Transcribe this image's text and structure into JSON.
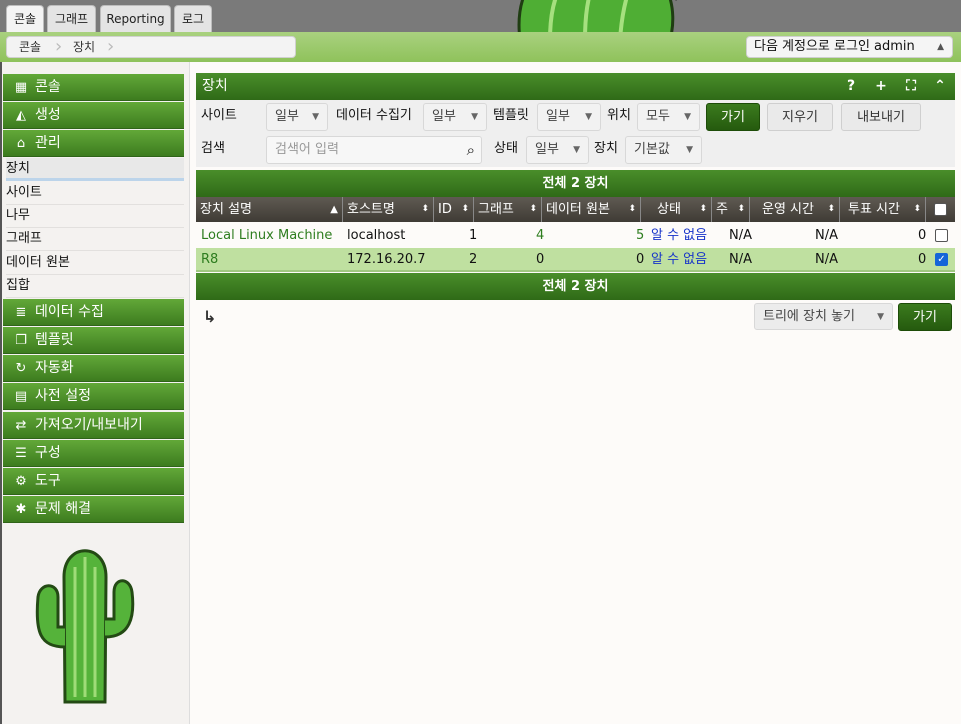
{
  "tabs": [
    {
      "label": "콘솔",
      "active": true
    },
    {
      "label": "그래프",
      "active": false
    },
    {
      "label": "Reporting",
      "active": false
    },
    {
      "label": "로그",
      "active": false
    }
  ],
  "breadcrumb": [
    "콘솔",
    "장치"
  ],
  "login_text": "다음 계정으로 로그인 admin",
  "sidebar": {
    "sections": [
      {
        "label": "콘솔",
        "icon": "map-icon"
      },
      {
        "label": "생성",
        "icon": "area-chart-icon"
      },
      {
        "label": "관리",
        "icon": "home-icon"
      }
    ],
    "manage_items": [
      "장치",
      "사이트",
      "나무",
      "그래프",
      "데이터 원본",
      "집합"
    ],
    "more_sections": [
      {
        "label": "데이터 수집",
        "icon": "database-icon"
      },
      {
        "label": "템플릿",
        "icon": "copy-icon"
      },
      {
        "label": "자동화",
        "icon": "sync-icon"
      },
      {
        "label": "사전 설정",
        "icon": "archive-icon"
      },
      {
        "label": "가져오기/내보내기",
        "icon": "exchange-icon"
      },
      {
        "label": "구성",
        "icon": "sliders-icon"
      },
      {
        "label": "도구",
        "icon": "cogs-icon"
      },
      {
        "label": "문제 해결",
        "icon": "bug-icon"
      }
    ]
  },
  "panel": {
    "title": "장치",
    "icons": [
      "help-icon",
      "add-icon",
      "fullscreen-icon",
      "collapse-icon"
    ]
  },
  "filters": {
    "site_label": "사이트",
    "site_value": "일부",
    "collector_label": "데이터 수집기",
    "collector_value": "일부",
    "template_label": "템플릿",
    "template_value": "일부",
    "location_label": "위치",
    "location_value": "모두",
    "go": "가기",
    "clear": "지우기",
    "export": "내보내기",
    "search_label": "검색",
    "search_placeholder": "검색어 입력",
    "status_label": "상태",
    "status_value": "일부",
    "device_label": "장치",
    "device_value": "기본값"
  },
  "table": {
    "caption": "전체 2 장치",
    "columns": [
      "장치 설명",
      "호스트명",
      "ID",
      "그래프",
      "데이터 원본",
      "상태",
      "주",
      "운영 시간",
      "투표 시간"
    ],
    "rows": [
      {
        "desc": "Local Linux Machine",
        "host": "localhost",
        "id": "1",
        "graphs": "4",
        "sources": "5",
        "status": "알 수 없음",
        "primary": "N/A",
        "uptime": "N/A",
        "poll": "0",
        "checked": false
      },
      {
        "desc": "R8",
        "host": "172.16.20.7",
        "id": "2",
        "graphs": "0",
        "sources": "0",
        "status": "알 수 없음",
        "primary": "N/A",
        "uptime": "N/A",
        "poll": "0",
        "checked": true
      }
    ]
  },
  "action": {
    "select_value": "트리에 장치 놓기",
    "go": "가기"
  },
  "colors": {
    "accent_green": "#2f6a17",
    "selected_row": "#bfe0a0",
    "link_green": "#2e7d1f",
    "status_blue": "#1734c9"
  }
}
